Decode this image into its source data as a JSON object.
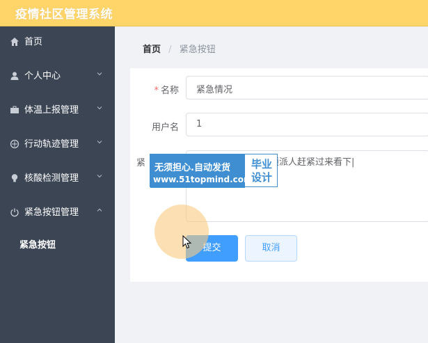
{
  "header": {
    "title": "疫情社区管理系统"
  },
  "sidebar": {
    "items": [
      {
        "label": "首页",
        "icon": "home-icon",
        "expandable": false
      },
      {
        "label": "个人中心",
        "icon": "user-icon",
        "expandable": true
      },
      {
        "label": "体温上报管理",
        "icon": "briefcase-icon",
        "expandable": true
      },
      {
        "label": "行动轨迹管理",
        "icon": "compass-icon",
        "expandable": true
      },
      {
        "label": "核酸检测管理",
        "icon": "bulb-icon",
        "expandable": true
      },
      {
        "label": "紧急按钮管理",
        "icon": "power-icon",
        "expandable": true,
        "expanded": true
      }
    ],
    "sub_items": [
      {
        "label": "紧急按钮"
      }
    ]
  },
  "breadcrumb": {
    "home": "首页",
    "separator": "/",
    "current": "紧急按钮"
  },
  "form": {
    "name_label": "名称",
    "name_required_mark": "*",
    "name_value": "紧急情况",
    "username_label": "用户名",
    "username_value": "1",
    "content_label": "紧",
    "content_value": "烦派人赶紧过来看下|",
    "submit_label": "提交",
    "cancel_label": "取消"
  },
  "watermark": {
    "line1": "无须担心.自动发货",
    "line2": "www.51topmind.com",
    "right": "毕业设计"
  },
  "colors": {
    "header_bg": "#ffd56a",
    "sidebar_bg": "#3b4554",
    "primary": "#409eff"
  }
}
